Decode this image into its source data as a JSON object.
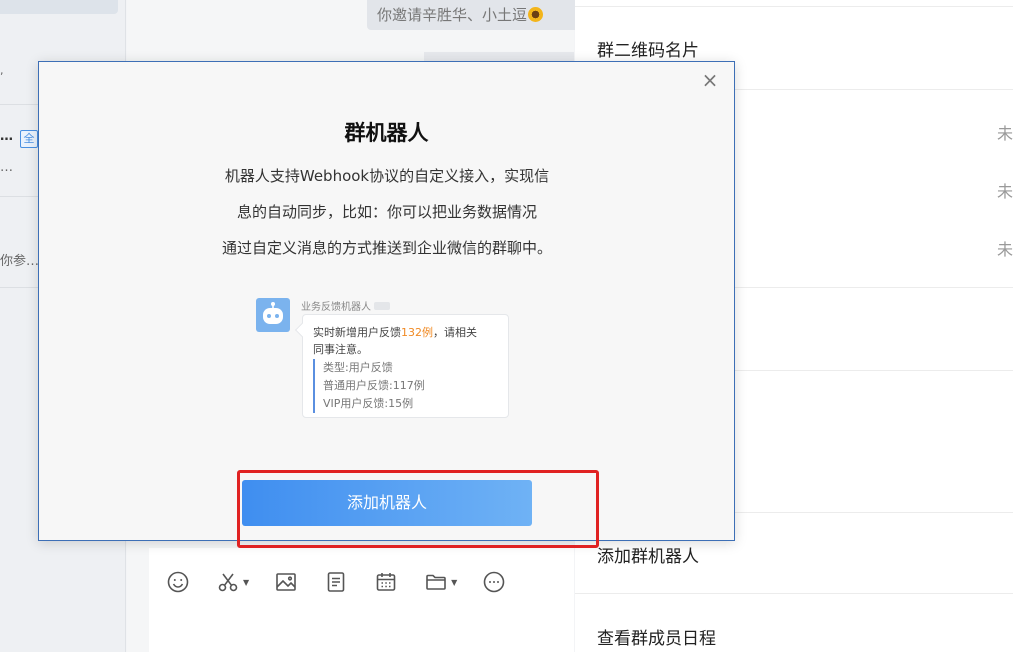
{
  "left_pane": {
    "item_name": "…",
    "item_tag": "全",
    "item_preview": "…",
    "item2_preview": "你参…"
  },
  "chat": {
    "message": "你邀请辛胜华、小土逗"
  },
  "right_panel": {
    "items": {
      "qr_card": "群二维码名片",
      "add_robot": "添加群机器人",
      "member_schedule": "查看群成员日程"
    },
    "right_values": [
      "未",
      "未",
      "未"
    ]
  },
  "modal": {
    "title": "群机器人",
    "description_lines": [
      "机器人支持Webhook协议的自定义接入，实现信",
      "息的自动同步，比如：你可以把业务数据情况",
      "通过自定义消息的方式推送到企业微信的群聊中。"
    ],
    "close_symbol": "×",
    "illustration": {
      "sender": "业务反馈机器人",
      "head_prefix": "实时新增用户反馈",
      "head_highlight": "132例",
      "head_suffix": "，请相关",
      "head_line2": "同事注意。",
      "list": [
        "类型:用户反馈",
        "普通用户反馈:117例",
        "VIP用户反馈:15例"
      ]
    },
    "add_button": "添加机器人"
  },
  "colors": {
    "accent": "#3f8ef0",
    "highlight_box": "#e02222",
    "highlight_text": "#f08a24",
    "modal_border": "#3d6fb6"
  }
}
